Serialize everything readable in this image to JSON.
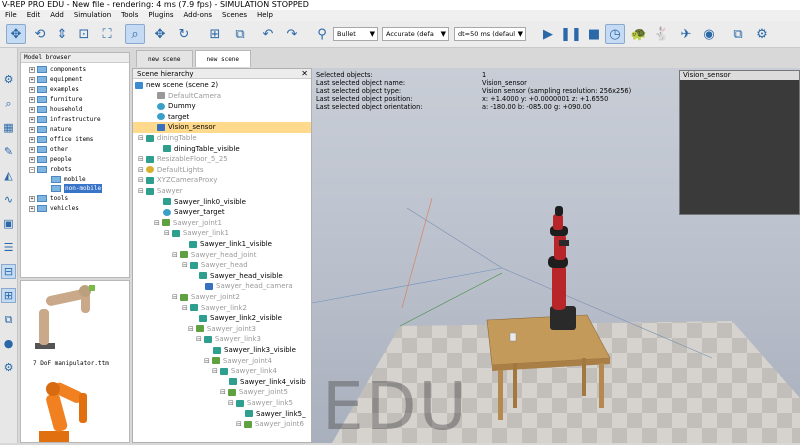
{
  "window": {
    "title": "V-REP PRO EDU - New file - rendering: 4 ms (7.9 fps) - SIMULATION STOPPED"
  },
  "menu": [
    "File",
    "Edit",
    "Add",
    "Simulation",
    "Tools",
    "Plugins",
    "Add-ons",
    "Scenes",
    "Help"
  ],
  "toolbar": {
    "engine": "Bullet",
    "accuracy": "Accurate (defa",
    "timestep": "dt=50 ms (defaul"
  },
  "model_browser": {
    "header": "Model browser",
    "items": [
      "components",
      "equipment",
      "examples",
      "furniture",
      "household",
      "infrastructure",
      "nature",
      "office items",
      "other",
      "people",
      "robots",
      "mobile",
      "non-mobile",
      "tools",
      "vehicles"
    ],
    "preview_labels": [
      "7 DoF manipulator.ttm"
    ]
  },
  "scene_tabs": [
    "new scene",
    "new scene"
  ],
  "hierarchy": {
    "header": "Scene hierarchy",
    "rows": [
      "new scene (scene 2)",
      "DefaultCamera",
      "Dummy",
      "target",
      "Vision_sensor",
      "diningTable",
      "diningTable_visible",
      "ResizableFloor_5_25",
      "DefaultLights",
      "XYZCameraProxy",
      "Sawyer",
      "Sawyer_link0_visible",
      "Sawyer_target",
      "Sawyer_joint1",
      "Sawyer_link1",
      "Sawyer_link1_visible",
      "Sawyer_head_joint",
      "Sawyer_head",
      "Sawyer_head_visible",
      "Sawyer_head_camera",
      "Sawyer_joint2",
      "Sawyer_link2",
      "Sawyer_link2_visible",
      "Sawyer_joint3",
      "Sawyer_link3",
      "Sawyer_link3_visible",
      "Sawyer_joint4",
      "Sawyer_link4",
      "Sawyer_link4_visib",
      "Sawyer_joint5",
      "Sawyer_link5",
      "Sawyer_link5_",
      "Sawyer_joint6"
    ]
  },
  "selection_info": {
    "rows": [
      {
        "label": "Selected objects:",
        "value": "1"
      },
      {
        "label": "Last selected object name:",
        "value": "Vision_sensor"
      },
      {
        "label": "Last selected object type:",
        "value": "Vision sensor (sampling resolution: 256x256)"
      },
      {
        "label": "Last selected object position:",
        "value": "x: +1.4000    y: +0.0000001    z: +1.6550"
      },
      {
        "label": "Last selected object orientation:",
        "value": "a: -180.00    b: -085.00    g: +090.00"
      }
    ]
  },
  "sensor_panel": {
    "title": "Vision_sensor"
  },
  "watermark": "EDU"
}
